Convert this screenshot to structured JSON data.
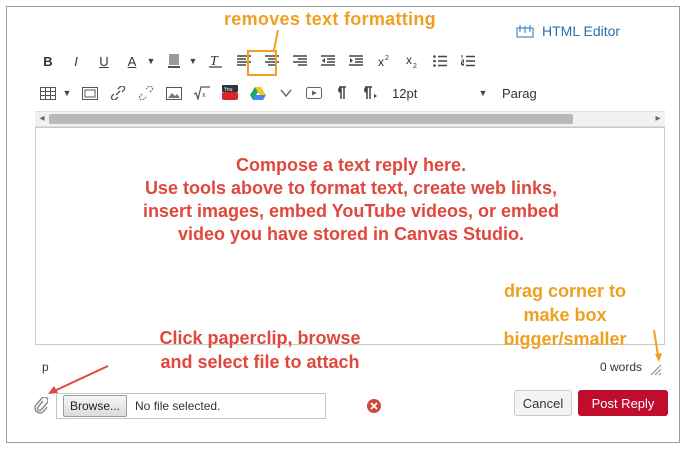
{
  "editor_link": {
    "label": "HTML Editor",
    "icon": "edit-source-icon"
  },
  "annotations": {
    "top_note": "removes text formatting",
    "compose_note": [
      "Compose a text reply here.",
      "Use tools above to format text, create web links,",
      "insert images, embed YouTube videos, or embed",
      "video you have stored in Canvas Studio."
    ],
    "attach_note": [
      "Click paperclip, browse",
      "and select file to attach"
    ],
    "drag_note": [
      "drag corner to",
      "make box",
      "bigger/smaller"
    ]
  },
  "toolbar": {
    "row1": [
      {
        "name": "bold-button",
        "label": "B",
        "icon": "bold-icon"
      },
      {
        "name": "italic-button",
        "label": "I",
        "icon": "italic-icon"
      },
      {
        "name": "underline-button",
        "label": "U",
        "icon": "underline-icon"
      },
      {
        "name": "text-color-button",
        "label": "A",
        "icon": "text-color-icon"
      },
      {
        "name": "background-color-button",
        "icon": "highlight-icon"
      },
      {
        "name": "clear-formatting-button",
        "icon": "clear-formatting-icon"
      },
      {
        "name": "align-left-button",
        "icon": "align-left-icon"
      },
      {
        "name": "align-center-button",
        "icon": "align-center-icon"
      },
      {
        "name": "align-right-button",
        "icon": "align-right-icon"
      },
      {
        "name": "outdent-button",
        "icon": "outdent-icon"
      },
      {
        "name": "indent-button",
        "icon": "indent-icon"
      },
      {
        "name": "superscript-button",
        "icon": "superscript-icon"
      },
      {
        "name": "subscript-button",
        "icon": "subscript-icon"
      },
      {
        "name": "bullet-list-button",
        "icon": "bullet-list-icon"
      },
      {
        "name": "numbered-list-button",
        "icon": "numbered-list-icon"
      }
    ],
    "row2": [
      {
        "name": "table-button",
        "icon": "table-icon"
      },
      {
        "name": "media-button",
        "icon": "media-icon"
      },
      {
        "name": "link-button",
        "icon": "link-icon"
      },
      {
        "name": "unlink-button",
        "icon": "unlink-icon"
      },
      {
        "name": "image-button",
        "icon": "image-icon"
      },
      {
        "name": "equation-button",
        "icon": "equation-icon"
      },
      {
        "name": "youtube-button",
        "icon": "youtube-icon"
      },
      {
        "name": "google-drive-button",
        "icon": "google-drive-icon"
      },
      {
        "name": "dropdown-button",
        "icon": "chevron-down-icon"
      },
      {
        "name": "record-media-button",
        "icon": "record-media-icon"
      },
      {
        "name": "ltr-button",
        "icon": "ltr-icon"
      },
      {
        "name": "rtl-button",
        "icon": "rtl-icon"
      }
    ],
    "font_size": "12pt",
    "paragraph": "Parag"
  },
  "status": {
    "path": "p",
    "word_count": "0 words"
  },
  "attachment": {
    "browse_label": "Browse...",
    "file_status": "No file selected."
  },
  "buttons": {
    "cancel": "Cancel",
    "post_reply": "Post Reply"
  },
  "colors": {
    "annotation_red": "#e0473d",
    "annotation_orange": "#f0a020",
    "post_button": "#c00d2d",
    "link_blue": "#2f6ea5"
  }
}
